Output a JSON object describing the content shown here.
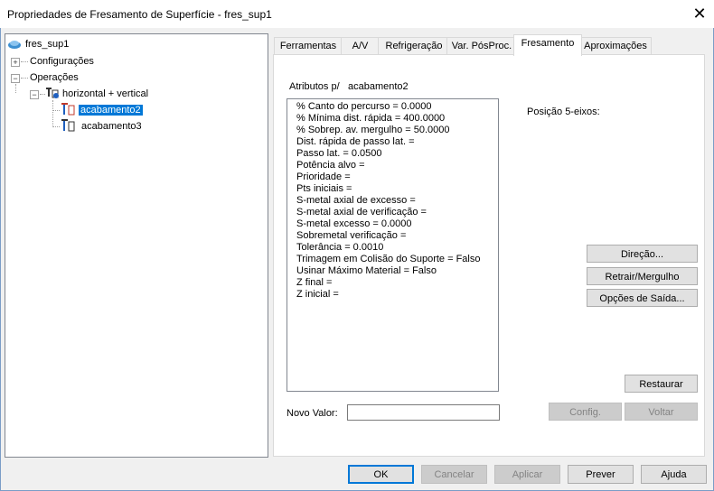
{
  "window": {
    "title": "Propriedades de Fresamento de Superfície - fres_sup1",
    "close": "✕"
  },
  "tree": {
    "root": "fres_sup1",
    "configuracoes": "Configurações",
    "operacoes": "Operações",
    "group": "horizontal + vertical",
    "ops": [
      "acabamento2",
      "acabamento3"
    ]
  },
  "tabs": [
    "Ferramentas",
    "A/V",
    "Refrigeração",
    "Var. PósProc.",
    "Fresamento",
    "Aproximações"
  ],
  "panel": {
    "attr_label": "Atributos p/",
    "attr_target": "acabamento2",
    "pos5": "Posição 5-eixos:",
    "attributes": [
      "% Canto do percurso = 0.0000",
      "% Mínima dist. rápida = 400.0000",
      "% Sobrep. av. mergulho = 50.0000",
      "Dist. rápida de passo lat. =",
      "Passo lat. = 0.0500",
      "Potência alvo =",
      "Prioridade =",
      "Pts iniciais =",
      "S-metal axial de excesso =",
      "S-metal axial de verificação =",
      "S-metal excesso = 0.0000",
      "Sobremetal verificação =",
      "Tolerância = 0.0010",
      "Trimagem em Colisão do Suporte = Falso",
      "Usinar Máximo Material = Falso",
      "Z final =",
      "Z inicial ="
    ],
    "novo_valor": "Novo Valor:",
    "novo_valor_value": "",
    "btn_direcao": "Direção...",
    "btn_retrair": "Retrair/Mergulho",
    "btn_opcoes": "Opções de Saída...",
    "btn_restaurar": "Restaurar",
    "btn_config": "Config.",
    "btn_voltar": "Voltar"
  },
  "footer": {
    "ok": "OK",
    "cancelar": "Cancelar",
    "aplicar": "Aplicar",
    "prever": "Prever",
    "ajuda": "Ajuda"
  }
}
